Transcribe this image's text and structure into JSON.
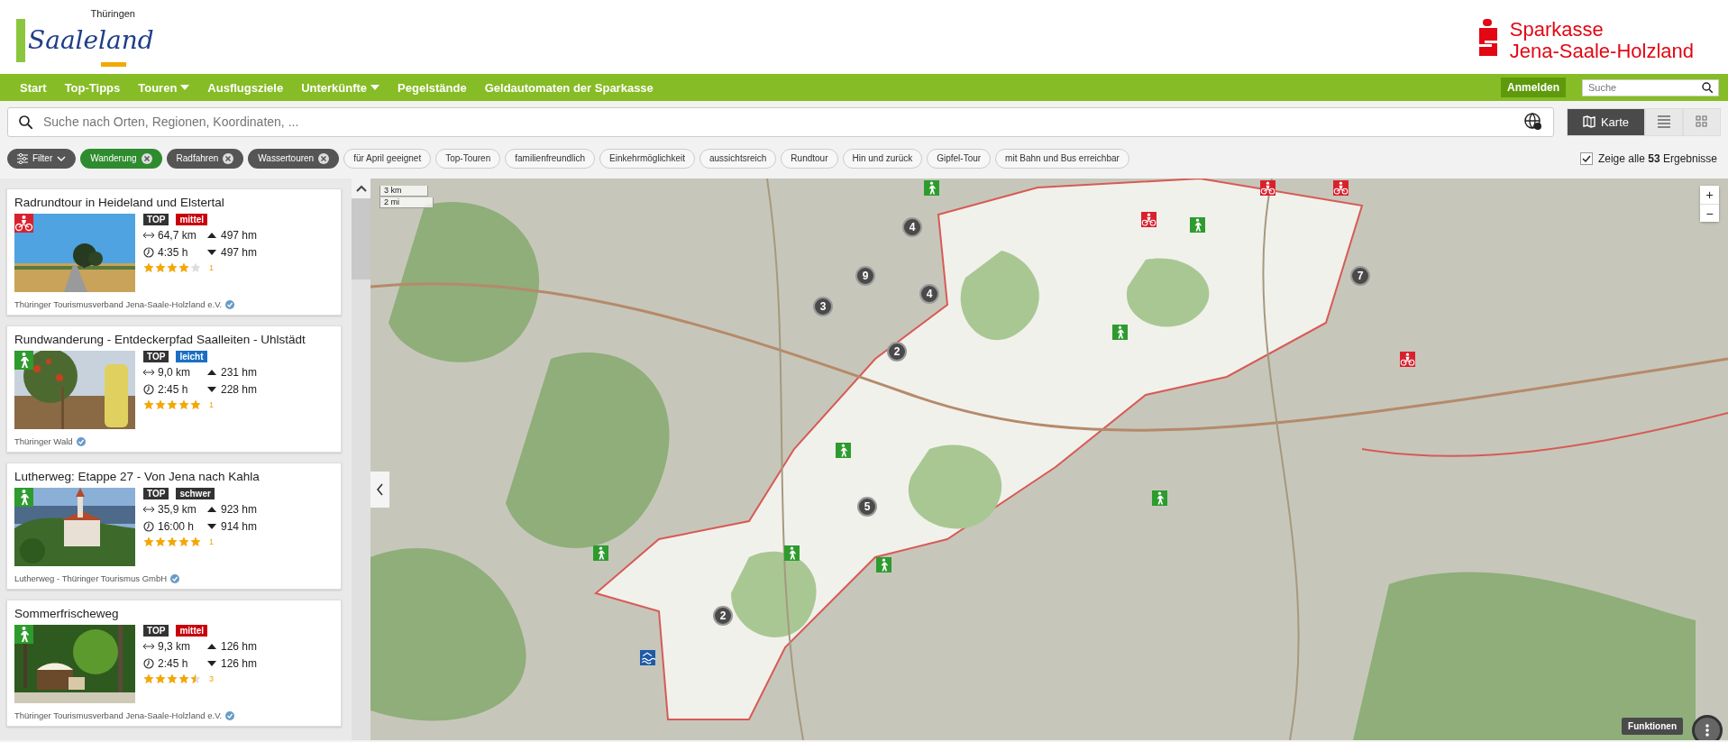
{
  "header": {
    "logo_region": "Thüringen",
    "logo_name": "Saaleland",
    "bank_name": "Sparkasse",
    "bank_region": "Jena-Saale-Holzland"
  },
  "nav": {
    "items": [
      {
        "label": "Start",
        "dropdown": false
      },
      {
        "label": "Top-Tipps",
        "dropdown": false
      },
      {
        "label": "Touren",
        "dropdown": true
      },
      {
        "label": "Ausflugsziele",
        "dropdown": false
      },
      {
        "label": "Unterkünfte",
        "dropdown": true
      },
      {
        "label": "Pegelstände",
        "dropdown": false
      },
      {
        "label": "Geldautomaten der Sparkasse",
        "dropdown": false
      }
    ],
    "login": "Anmelden",
    "search_placeholder": "Suche"
  },
  "search": {
    "placeholder": "Suche nach Orten, Regionen, Koordinaten, ..."
  },
  "views": [
    {
      "kind": "map",
      "label": "Karte",
      "selected": true
    },
    {
      "kind": "list",
      "selected": false
    },
    {
      "kind": "grid",
      "selected": false
    }
  ],
  "filter_button": "Filter",
  "chips": [
    {
      "label": "Wanderung",
      "selected": true,
      "color": "#2e8b2e"
    },
    {
      "label": "Radfahren",
      "selected": true,
      "color": "#555555"
    },
    {
      "label": "Wassertouren",
      "selected": true,
      "color": "#555555"
    },
    {
      "label": "für April geeignet",
      "selected": false
    },
    {
      "label": "Top-Touren",
      "selected": false
    },
    {
      "label": "familienfreundlich",
      "selected": false
    },
    {
      "label": "Einkehrmöglichkeit",
      "selected": false
    },
    {
      "label": "aussichtsreich",
      "selected": false
    },
    {
      "label": "Rundtour",
      "selected": false
    },
    {
      "label": "Hin und zurück",
      "selected": false
    },
    {
      "label": "Gipfel-Tour",
      "selected": false
    },
    {
      "label": "mit Bahn und Bus erreichbar",
      "selected": false
    }
  ],
  "show_all": {
    "label": "Zeige alle **53** Ergebnisse",
    "checked": true
  },
  "tours": [
    {
      "title": "Radrundtour in Heideland und Elstertal",
      "kind": "cycling",
      "top": "TOP",
      "difficulty": {
        "label": "mittel",
        "color": "#c8000a"
      },
      "distance": "64,7 km",
      "duration": "4:35 h",
      "ascent": "497 hm",
      "descent": "497 hm",
      "stars": 4,
      "rating_count": "1",
      "provider": "Thüringer Tourismusverband Jena-Saale-Holzland e.V."
    },
    {
      "title": "Rundwanderung - Entdeckerpfad Saalleiten - Uhlstädt",
      "kind": "hiking",
      "top": "TOP",
      "difficulty": {
        "label": "leicht",
        "color": "#1a6fc4"
      },
      "distance": "9,0 km",
      "duration": "2:45 h",
      "ascent": "231 hm",
      "descent": "228 hm",
      "stars": 5,
      "rating_count": "1",
      "provider": "Thüringer Wald"
    },
    {
      "title": "Lutherweg: Etappe 27 - Von Jena nach Kahla",
      "kind": "hiking",
      "top": "TOP",
      "difficulty": {
        "label": "schwer",
        "color": "#333333"
      },
      "distance": "35,9 km",
      "duration": "16:00 h",
      "ascent": "923 hm",
      "descent": "914 hm",
      "stars": 5,
      "rating_count": "1",
      "provider": "Lutherweg - Thüringer Tourismus GmbH"
    },
    {
      "title": "Sommerfrischeweg",
      "kind": "hiking",
      "top": "TOP",
      "difficulty": {
        "label": "mittel",
        "color": "#c8000a"
      },
      "distance": "9,3 km",
      "duration": "2:45 h",
      "ascent": "126 hm",
      "descent": "126 hm",
      "stars": 4.5,
      "rating_count": "3",
      "provider": "Thüringer Tourismusverband Jena-Saale-Holzland e.V."
    }
  ],
  "map": {
    "scale": [
      "3 km",
      "2 mi"
    ],
    "clusters": [
      {
        "count": "4"
      },
      {
        "count": "9"
      },
      {
        "count": "3"
      },
      {
        "count": "4"
      },
      {
        "count": "2"
      },
      {
        "count": "7"
      },
      {
        "count": "5"
      },
      {
        "count": "2"
      }
    ],
    "markers": [
      {
        "kind": "hiking"
      },
      {
        "kind": "hiking"
      },
      {
        "kind": "hiking"
      },
      {
        "kind": "hiking"
      },
      {
        "kind": "hiking"
      },
      {
        "kind": "hiking"
      },
      {
        "kind": "hiking"
      },
      {
        "kind": "hiking"
      },
      {
        "kind": "cycling"
      },
      {
        "kind": "cycling"
      },
      {
        "kind": "cycling"
      },
      {
        "kind": "cycling"
      },
      {
        "kind": "water"
      }
    ],
    "zoom_in": "+",
    "zoom_out": "−",
    "functions": "Funktionen"
  }
}
